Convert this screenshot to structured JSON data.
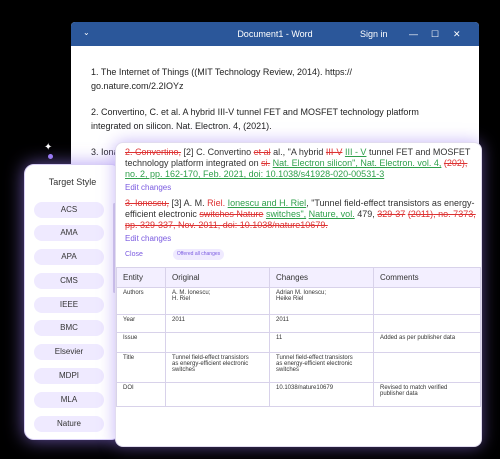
{
  "word": {
    "dropdown_icon": "chevron-down",
    "title": "Document1 - Word",
    "signin": "Sign in",
    "refs": [
      "1. The Internet of Things ((MIT Technology Review, 2014). https://",
      "go.nature.com/2.2IOYz",
      "2. Convertino, C. et al. A hybrid III-V tunnel FET and MOSFET technology platform",
      "integrated on silicon. Nat. Electron. 4, (2021).",
      "3. Iona"
    ]
  },
  "panel": {
    "title": "Target Style",
    "styles": [
      "ACS",
      "AMA",
      "APA",
      "CMS",
      "IEEE",
      "BMC",
      "Elsevier",
      "MDPI",
      "MLA",
      "Nature"
    ]
  },
  "card": {
    "ref2": {
      "deleted_author": "2. Convertino,",
      "number": "[2]",
      "author": "C. Convertino",
      "deleted_etal": "et al",
      "text1": "al., \"A hybrid",
      "deleted_iii": "III-V",
      "inserted_iii": "III - V",
      "text2": "tunnel FET and MOSFET technology platform integrated on",
      "deleted_si": "si.",
      "inserted_journal": "Nat. Electron silicon\", Nat. Electron. vol. 4,",
      "deleted_year": "(202",
      "deleted_year_rest": "),",
      "inserted_tail": "no. 2, pp. 162-170, Feb. 2021, doi: 10.1038/s41928-020-00531-3",
      "edit": "Edit changes"
    },
    "ref3": {
      "deleted_author": "3. Ionescu,",
      "number": "[3]",
      "author": "A. M.",
      "mark1": "Riel.",
      "ins1": "Ionescu and H. Riel",
      "text1": ", \"Tunnel field-effect transistors as energy-efficient electronic",
      "deleted_sw": "switches Nature",
      "inserted_sw": "switches\",",
      "inserted_journal": "Nature, vol.",
      "text2": "479,",
      "deleted_pages": "329-37",
      "deleted_year": "(2011)",
      "inserted_tail": ", no. 7373, pp. 329-337, Nov. 2011, doi: 10.1038/nature10679.",
      "edit": "Edit changes"
    },
    "close": "Close",
    "offset_pill": "Offered all changes",
    "table": {
      "headers": [
        "Entity",
        "Original",
        "Changes",
        "Comments"
      ],
      "rows": [
        [
          "Authors",
          "A. M. Ionescu;\nH. Riel",
          "Adrian M. Ionescu;\nHeike Riel",
          ""
        ],
        [
          "Year",
          "2011",
          "2011",
          ""
        ],
        [
          "Issue",
          "",
          "11",
          "Added as per publisher data"
        ],
        [
          "Title",
          "Tunnel field-effect transistors\nas energy-efficient electronic\nswitches",
          "Tunnel field-effect transistors\nas energy-efficient electronic\nswitches",
          ""
        ],
        [
          "DOI",
          "",
          "10.1038/nature10679",
          "Revised to match verified\npublisher data"
        ]
      ]
    }
  }
}
